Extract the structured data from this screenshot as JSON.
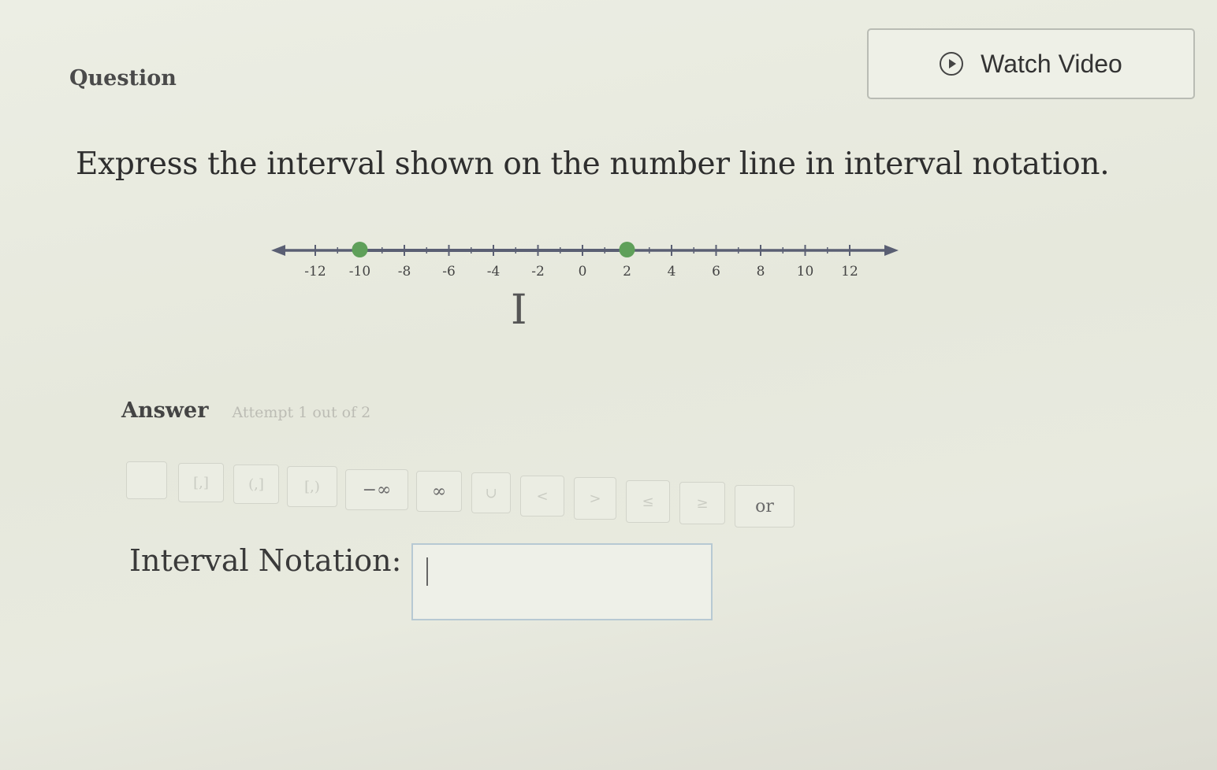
{
  "question": {
    "label": "Question",
    "watch_video_label": "Watch Video",
    "prompt": "Express the interval shown on the number line in interval notation."
  },
  "number_line": {
    "ticks": [
      "-12",
      "-10",
      "-8",
      "-6",
      "-4",
      "-2",
      "0",
      "2",
      "4",
      "6",
      "8",
      "10",
      "12"
    ],
    "tick_values": [
      -12,
      -10,
      -8,
      -6,
      -4,
      -2,
      0,
      2,
      4,
      6,
      8,
      10,
      12
    ],
    "left_arrow": true,
    "right_arrow": true,
    "closed_points": [
      -10,
      2
    ],
    "point_color": "#5fa05a",
    "line_color": "#5a5f73"
  },
  "answer": {
    "label": "Answer",
    "attempt_text": "Attempt 1 out of 2"
  },
  "toolbar": {
    "buttons": [
      {
        "name": "blank-button",
        "label": "",
        "dark": false
      },
      {
        "name": "closed-interval-button",
        "label": "[,]",
        "dark": false
      },
      {
        "name": "half-open-left-button",
        "label": "(,]",
        "dark": false
      },
      {
        "name": "half-open-right-button",
        "label": "[,)",
        "dark": false
      },
      {
        "name": "negative-infinity-button",
        "label": "−∞",
        "dark": true
      },
      {
        "name": "infinity-button",
        "label": "∞",
        "dark": true
      },
      {
        "name": "union-button",
        "label": "∪",
        "dark": false
      },
      {
        "name": "less-than-button",
        "label": "<",
        "dark": false
      },
      {
        "name": "greater-than-button",
        "label": ">",
        "dark": false
      },
      {
        "name": "less-equal-button",
        "label": "≤",
        "dark": false
      },
      {
        "name": "greater-equal-button",
        "label": "≥",
        "dark": false
      },
      {
        "name": "or-button",
        "label": "or",
        "dark": true
      }
    ]
  },
  "interval": {
    "label": "Interval Notation:",
    "value": ""
  }
}
